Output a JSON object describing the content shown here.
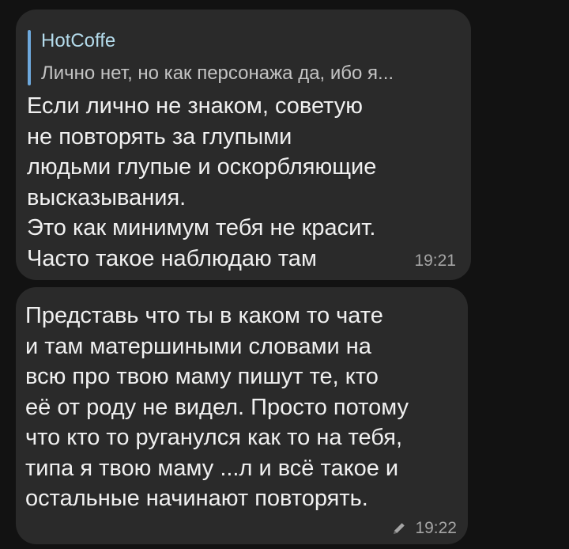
{
  "messages": [
    {
      "reply": {
        "sender": "HotCoffe",
        "text": "Лично нет, но как персонажа да, ибо я..."
      },
      "lines": [
        "Если лично не знаком, советую",
        "не повторять за глупыми",
        "людьми глупые и оскорбляющие",
        "высказывания.",
        "Это как минимум тебя не красит.",
        "Часто такое наблюдаю там"
      ],
      "time": "19:21"
    },
    {
      "lines": [
        "Представь что ты в каком то чате",
        "и там матершиными словами на",
        "всю про твою маму пишут те, кто",
        "её от роду не видел. Просто потому",
        "что кто то руганулся как то на тебя,",
        "типа я твою маму ...л и всё такое и",
        "остальные начинают повторять."
      ],
      "time": "19:22",
      "edited_icon": "pencil-icon"
    }
  ],
  "colors": {
    "background": "#121212",
    "bubble": "#2a2a2a",
    "reply_accent": "#6ea9dd",
    "reply_sender": "#b4dbeb",
    "text": "#f0f0f0",
    "meta": "#a5a5a5"
  }
}
